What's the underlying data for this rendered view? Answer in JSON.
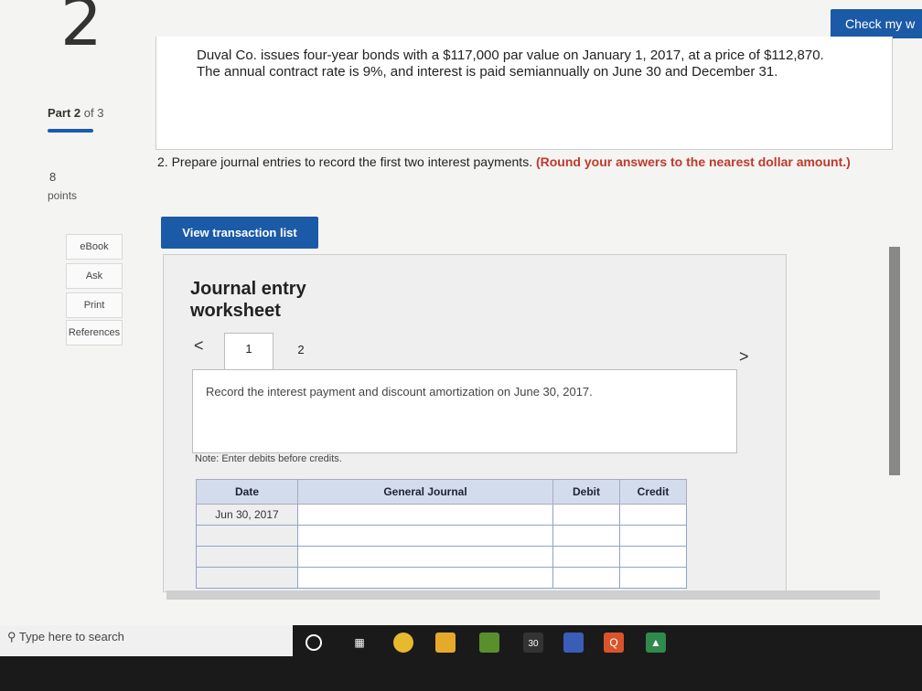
{
  "header": {
    "question_number": "2",
    "part_prefix": "Part",
    "part_num": "2",
    "part_suffix": "of 3",
    "points_value": "8",
    "points_label": "points",
    "check_button": "Check my w"
  },
  "sidebar": {
    "items": [
      {
        "label": "eBook"
      },
      {
        "label": "Ask"
      },
      {
        "label": "Print"
      },
      {
        "label": "References"
      }
    ]
  },
  "problem": {
    "text": "Duval Co. issues four-year bonds with a $117,000 par value on January 1, 2017, at a price of $112,870. The annual contract rate is 9%, and interest is paid semiannually on June 30 and December 31."
  },
  "instruction": {
    "text": "2. Prepare journal entries to record the first two interest payments.",
    "note": "(Round your answers to the nearest dollar amount.)"
  },
  "view_transaction_button": "View transaction list",
  "worksheet": {
    "title": "Journal entry worksheet",
    "tabs": [
      "1",
      "2"
    ],
    "prev": "<",
    "next": ">",
    "record_text": "Record the interest payment and discount amortization on June 30, 2017.",
    "note": "Note: Enter debits before credits.",
    "columns": [
      "Date",
      "General Journal",
      "Debit",
      "Credit"
    ],
    "rows": [
      {
        "date": "Jun 30, 2017"
      },
      {
        "date": ""
      },
      {
        "date": ""
      },
      {
        "date": ""
      },
      {
        "date": ""
      }
    ]
  },
  "taskbar": {
    "search_placeholder": "Type here to search",
    "badge": "30"
  },
  "colors": {
    "accent": "#1a5aa6",
    "warning": "#c0392b"
  }
}
